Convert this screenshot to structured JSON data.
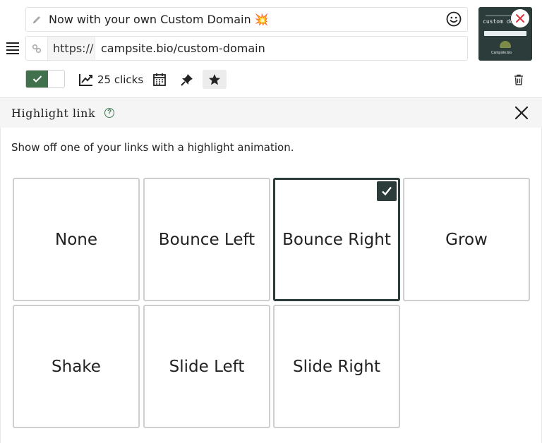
{
  "link": {
    "title_value": "Now with your own Custom Domain 💥",
    "url_prefix": "https://",
    "url_value": "campsite.bio/custom-domain",
    "thumbnail": {
      "title": "custom do",
      "footer": "Campsite.bio"
    },
    "enabled": true,
    "clicks_label": "25 clicks"
  },
  "panel": {
    "title": "Highlight link",
    "help_glyph": "?",
    "description": "Show off one of your links with a highlight animation.",
    "options": [
      {
        "label": "None"
      },
      {
        "label": "Bounce Left"
      },
      {
        "label": "Bounce Right"
      },
      {
        "label": "Grow"
      },
      {
        "label": "Shake"
      },
      {
        "label": "Slide Left"
      },
      {
        "label": "Slide Right"
      }
    ],
    "selected_option": "Bounce Right"
  },
  "colors": {
    "accent_dark": "#2b3c3a",
    "toggle_green": "#41704d",
    "remove_red": "#d9363e"
  },
  "icons": [
    "drag-handle-icon",
    "pencil-icon",
    "smiley-icon",
    "link-icon",
    "close-circle-icon",
    "check-icon",
    "chart-icon",
    "calendar-icon",
    "pin-icon",
    "star-icon",
    "trash-icon",
    "help-icon",
    "close-icon"
  ]
}
